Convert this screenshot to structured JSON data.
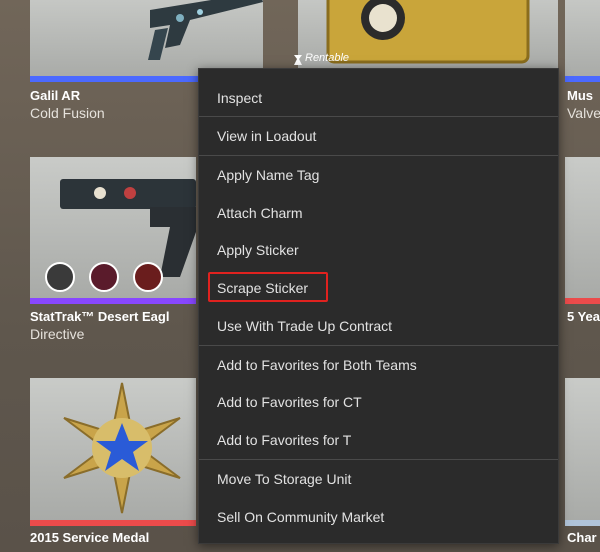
{
  "items": [
    {
      "name": "Galil AR",
      "skin": "Cold Fusion",
      "rarity_color": "#4b69ff"
    },
    {
      "name": "",
      "skin": "",
      "badge": "Rentable",
      "rarity_color": "#4b69ff"
    },
    {
      "name": "Mus",
      "skin": "Valve",
      "rarity_color": "#4b69ff"
    },
    {
      "name": "StatTrak™ Desert Eagl",
      "skin": "Directive",
      "rarity_color": "#8847ff"
    },
    {
      "name": "5 Yea",
      "skin": "",
      "rarity_color": "#eb4b4b"
    },
    {
      "name": "2015 Service Medal",
      "skin": "",
      "rarity_color": "#eb4b4b"
    },
    {
      "name": "Char",
      "skin": "",
      "rarity_color": "#b0c3d9"
    }
  ],
  "context_menu": {
    "items": [
      "Inspect",
      "View in Loadout",
      "Apply Name Tag",
      "Attach Charm",
      "Apply Sticker",
      "Scrape Sticker",
      "Use With Trade Up Contract",
      "Add to Favorites for Both Teams",
      "Add to Favorites for CT",
      "Add to Favorites for T",
      "Move To Storage Unit",
      "Sell On Community Market"
    ],
    "highlighted_item": "Scrape Sticker"
  },
  "colors": {
    "menu_bg": "#2b2b2b",
    "menu_text": "#e2e2e2",
    "highlight_border": "#e0221f"
  }
}
